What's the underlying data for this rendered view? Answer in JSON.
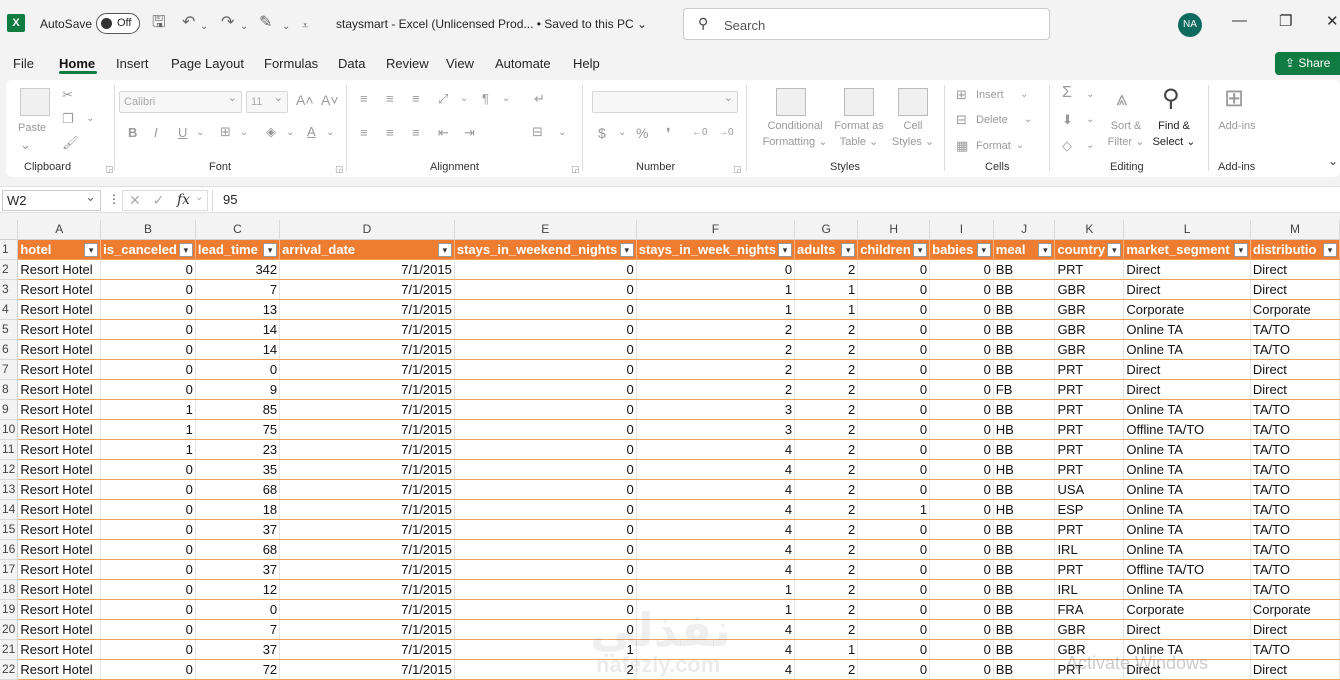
{
  "titlebar": {
    "logo": "X",
    "autosave_label": "AutoSave",
    "autosave_state": "Off",
    "doc_title": "staysmart  -  Excel (Unlicensed Prod...  •  Saved to this PC  ⌄",
    "search_placeholder": "Search",
    "avatar_initials": "NA"
  },
  "menu": {
    "tabs": [
      "File",
      "Home",
      "Insert",
      "Page Layout",
      "Formulas",
      "Data",
      "Review",
      "View",
      "Automate",
      "Help"
    ],
    "active": "Home",
    "share_label": "Share"
  },
  "ribbon": {
    "clipboard": {
      "group": "Clipboard",
      "paste": "Paste"
    },
    "font": {
      "group": "Font",
      "font_name": "Calibri",
      "font_size": "11"
    },
    "alignment": {
      "group": "Alignment"
    },
    "number": {
      "group": "Number"
    },
    "styles": {
      "group": "Styles",
      "conditional": "Conditional",
      "formatting": "Formatting ⌄",
      "format_as": "Format as",
      "table": "Table ⌄",
      "cell": "Cell",
      "cell_styles": "Styles ⌄"
    },
    "cells": {
      "group": "Cells",
      "insert": "Insert",
      "delete": "Delete",
      "format": "Format"
    },
    "editing": {
      "group": "Editing",
      "sort": "Sort &",
      "filter": "Filter ⌄",
      "find": "Find &",
      "select": "Select ⌄"
    },
    "addins": {
      "group": "Add-ins",
      "label": "Add-ins"
    }
  },
  "formula_bar": {
    "name_box": "W2",
    "value": "95"
  },
  "sheet": {
    "columns": [
      "A",
      "B",
      "C",
      "D",
      "E",
      "F",
      "G",
      "H",
      "I",
      "J",
      "K",
      "L",
      "M"
    ],
    "headers": [
      "hotel",
      "is_canceled",
      "lead_time",
      "arrival_date",
      "stays_in_weekend_nights",
      "stays_in_week_nights",
      "adults",
      "children",
      "babies",
      "meal",
      "country",
      "market_segment",
      "distributio"
    ],
    "rows": [
      [
        "Resort Hotel",
        "0",
        "342",
        "7/1/2015",
        "0",
        "0",
        "2",
        "0",
        "0",
        "BB",
        "PRT",
        "Direct",
        "Direct"
      ],
      [
        "Resort Hotel",
        "0",
        "7",
        "7/1/2015",
        "0",
        "1",
        "1",
        "0",
        "0",
        "BB",
        "GBR",
        "Direct",
        "Direct"
      ],
      [
        "Resort Hotel",
        "0",
        "13",
        "7/1/2015",
        "0",
        "1",
        "1",
        "0",
        "0",
        "BB",
        "GBR",
        "Corporate",
        "Corporate"
      ],
      [
        "Resort Hotel",
        "0",
        "14",
        "7/1/2015",
        "0",
        "2",
        "2",
        "0",
        "0",
        "BB",
        "GBR",
        "Online TA",
        "TA/TO"
      ],
      [
        "Resort Hotel",
        "0",
        "14",
        "7/1/2015",
        "0",
        "2",
        "2",
        "0",
        "0",
        "BB",
        "GBR",
        "Online TA",
        "TA/TO"
      ],
      [
        "Resort Hotel",
        "0",
        "0",
        "7/1/2015",
        "0",
        "2",
        "2",
        "0",
        "0",
        "BB",
        "PRT",
        "Direct",
        "Direct"
      ],
      [
        "Resort Hotel",
        "0",
        "9",
        "7/1/2015",
        "0",
        "2",
        "2",
        "0",
        "0",
        "FB",
        "PRT",
        "Direct",
        "Direct"
      ],
      [
        "Resort Hotel",
        "1",
        "85",
        "7/1/2015",
        "0",
        "3",
        "2",
        "0",
        "0",
        "BB",
        "PRT",
        "Online TA",
        "TA/TO"
      ],
      [
        "Resort Hotel",
        "1",
        "75",
        "7/1/2015",
        "0",
        "3",
        "2",
        "0",
        "0",
        "HB",
        "PRT",
        "Offline TA/TO",
        "TA/TO"
      ],
      [
        "Resort Hotel",
        "1",
        "23",
        "7/1/2015",
        "0",
        "4",
        "2",
        "0",
        "0",
        "BB",
        "PRT",
        "Online TA",
        "TA/TO"
      ],
      [
        "Resort Hotel",
        "0",
        "35",
        "7/1/2015",
        "0",
        "4",
        "2",
        "0",
        "0",
        "HB",
        "PRT",
        "Online TA",
        "TA/TO"
      ],
      [
        "Resort Hotel",
        "0",
        "68",
        "7/1/2015",
        "0",
        "4",
        "2",
        "0",
        "0",
        "BB",
        "USA",
        "Online TA",
        "TA/TO"
      ],
      [
        "Resort Hotel",
        "0",
        "18",
        "7/1/2015",
        "0",
        "4",
        "2",
        "1",
        "0",
        "HB",
        "ESP",
        "Online TA",
        "TA/TO"
      ],
      [
        "Resort Hotel",
        "0",
        "37",
        "7/1/2015",
        "0",
        "4",
        "2",
        "0",
        "0",
        "BB",
        "PRT",
        "Online TA",
        "TA/TO"
      ],
      [
        "Resort Hotel",
        "0",
        "68",
        "7/1/2015",
        "0",
        "4",
        "2",
        "0",
        "0",
        "BB",
        "IRL",
        "Online TA",
        "TA/TO"
      ],
      [
        "Resort Hotel",
        "0",
        "37",
        "7/1/2015",
        "0",
        "4",
        "2",
        "0",
        "0",
        "BB",
        "PRT",
        "Offline TA/TO",
        "TA/TO"
      ],
      [
        "Resort Hotel",
        "0",
        "12",
        "7/1/2015",
        "0",
        "1",
        "2",
        "0",
        "0",
        "BB",
        "IRL",
        "Online TA",
        "TA/TO"
      ],
      [
        "Resort Hotel",
        "0",
        "0",
        "7/1/2015",
        "0",
        "1",
        "2",
        "0",
        "0",
        "BB",
        "FRA",
        "Corporate",
        "Corporate"
      ],
      [
        "Resort Hotel",
        "0",
        "7",
        "7/1/2015",
        "0",
        "4",
        "2",
        "0",
        "0",
        "BB",
        "GBR",
        "Direct",
        "Direct"
      ],
      [
        "Resort Hotel",
        "0",
        "37",
        "7/1/2015",
        "1",
        "4",
        "1",
        "0",
        "0",
        "BB",
        "GBR",
        "Online TA",
        "TA/TO"
      ],
      [
        "Resort Hotel",
        "0",
        "72",
        "7/1/2015",
        "2",
        "4",
        "2",
        "0",
        "0",
        "BB",
        "PRT",
        "Direct",
        "Direct"
      ]
    ],
    "numeric_columns": [
      1,
      2,
      3,
      4,
      5,
      6,
      7,
      8
    ]
  },
  "overlay": {
    "watermark": "نفذلي",
    "watermark_url": "nafezly.com",
    "activate_text": "Activate Windows"
  }
}
